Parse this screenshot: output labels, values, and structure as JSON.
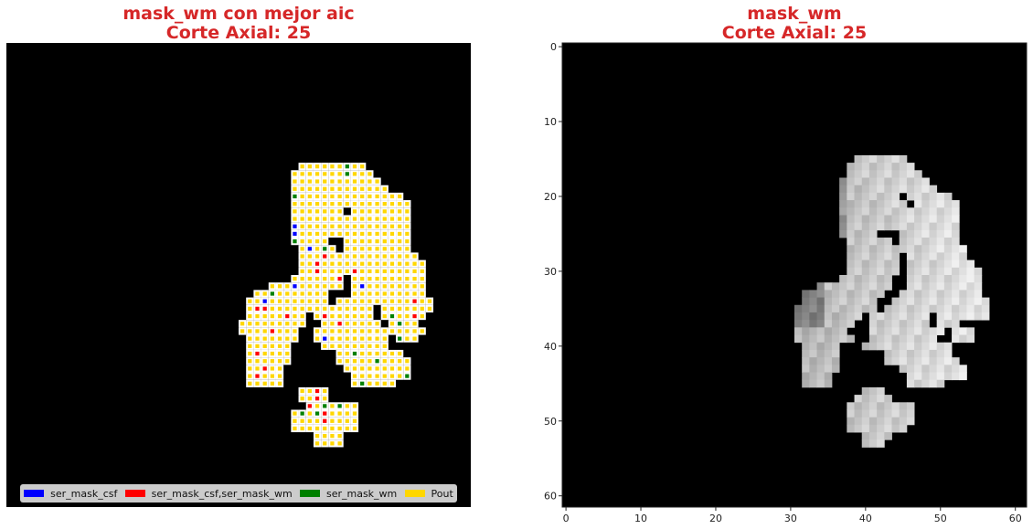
{
  "chart_data": [
    {
      "type": "heatmap",
      "title_line1": "mask_wm con mejor aic",
      "title_line2": "Corte Axial: 25",
      "grid_size": 62,
      "axes_visible": false,
      "legend_location": "bottom",
      "legend": [
        {
          "label": "ser_mask_csf",
          "color": "#0000ff"
        },
        {
          "label": "ser_mask_csf,ser_mask_wm",
          "color": "#ff0000"
        },
        {
          "label": "ser_mask_wm",
          "color": "#008000"
        },
        {
          "label": "Pout",
          "color": "#ffd700"
        }
      ],
      "row_spans": [
        [
          16,
          [
            [
              39,
              47
            ]
          ]
        ],
        [
          17,
          [
            [
              38,
              48
            ]
          ]
        ],
        [
          18,
          [
            [
              38,
              49
            ]
          ]
        ],
        [
          19,
          [
            [
              38,
              50
            ]
          ]
        ],
        [
          20,
          [
            [
              38,
              52
            ]
          ]
        ],
        [
          21,
          [
            [
              38,
              53
            ]
          ]
        ],
        [
          22,
          [
            [
              38,
              53
            ]
          ]
        ],
        [
          23,
          [
            [
              38,
              53
            ]
          ]
        ],
        [
          24,
          [
            [
              38,
              53
            ]
          ]
        ],
        [
          25,
          [
            [
              38,
              53
            ]
          ]
        ],
        [
          26,
          [
            [
              38,
              53
            ]
          ]
        ],
        [
          27,
          [
            [
              39,
              53
            ]
          ]
        ],
        [
          28,
          [
            [
              39,
              45
            ],
            [
              46,
              54
            ]
          ]
        ],
        [
          29,
          [
            [
              39,
              45
            ],
            [
              46,
              55
            ]
          ]
        ],
        [
          30,
          [
            [
              39,
              45
            ],
            [
              46,
              55
            ]
          ]
        ],
        [
          31,
          [
            [
              38,
              44
            ],
            [
              46,
              55
            ]
          ]
        ],
        [
          32,
          [
            [
              35,
              44
            ],
            [
              46,
              55
            ]
          ]
        ],
        [
          33,
          [
            [
              33,
              42
            ],
            [
              46,
              55
            ]
          ]
        ],
        [
          34,
          [
            [
              32,
              42
            ],
            [
              44,
              56
            ]
          ]
        ],
        [
          35,
          [
            [
              32,
              42
            ],
            [
              43,
              56
            ]
          ]
        ],
        [
          36,
          [
            [
              32,
              39
            ],
            [
              41,
              55
            ]
          ]
        ],
        [
          37,
          [
            [
              31,
              39
            ],
            [
              42,
              54
            ]
          ]
        ],
        [
          38,
          [
            [
              31,
              38
            ],
            [
              41,
              50
            ],
            [
              51,
              55
            ]
          ]
        ],
        [
          39,
          [
            [
              32,
              35
            ],
            [
              36,
              38
            ],
            [
              41,
              50
            ],
            [
              52,
              54
            ]
          ]
        ],
        [
          40,
          [
            [
              32,
              37
            ],
            [
              42,
              51
            ]
          ]
        ],
        [
          41,
          [
            [
              32,
              37
            ],
            [
              44,
              52
            ]
          ]
        ],
        [
          42,
          [
            [
              32,
              37
            ],
            [
              44,
              53
            ]
          ]
        ],
        [
          43,
          [
            [
              32,
              36
            ],
            [
              45,
              53
            ]
          ]
        ],
        [
          44,
          [
            [
              32,
              36
            ],
            [
              46,
              53
            ]
          ]
        ],
        [
          45,
          [
            [
              32,
              36
            ],
            [
              46,
              51
            ]
          ]
        ],
        [
          46,
          [
            [
              39,
              42
            ]
          ]
        ],
        [
          47,
          [
            [
              39,
              42
            ]
          ]
        ],
        [
          48,
          [
            [
              40,
              46
            ]
          ]
        ],
        [
          49,
          [
            [
              38,
              46
            ]
          ]
        ],
        [
          50,
          [
            [
              38,
              46
            ]
          ]
        ],
        [
          51,
          [
            [
              38,
              46
            ]
          ]
        ],
        [
          52,
          [
            [
              41,
              44
            ]
          ]
        ],
        [
          53,
          [
            [
              41,
              44
            ]
          ]
        ]
      ],
      "holes": [
        [
          22,
          45
        ],
        [
          26,
          43
        ],
        [
          26,
          44
        ],
        [
          27,
          44
        ],
        [
          35,
          49
        ],
        [
          36,
          49
        ],
        [
          37,
          50
        ],
        [
          40,
          51
        ]
      ],
      "markers": {
        "blue": [
          [
            24,
            38
          ],
          [
            25,
            38
          ],
          [
            27,
            40
          ],
          [
            32,
            38
          ],
          [
            32,
            47
          ],
          [
            34,
            34
          ],
          [
            37,
            41
          ],
          [
            39,
            42
          ],
          [
            40,
            41
          ]
        ],
        "red": [
          [
            28,
            42
          ],
          [
            29,
            41
          ],
          [
            30,
            41
          ],
          [
            30,
            46
          ],
          [
            31,
            44
          ],
          [
            34,
            54
          ],
          [
            35,
            33
          ],
          [
            35,
            34
          ],
          [
            36,
            37
          ],
          [
            36,
            42
          ],
          [
            36,
            54
          ],
          [
            37,
            44
          ],
          [
            38,
            35
          ],
          [
            39,
            31
          ],
          [
            41,
            33
          ],
          [
            43,
            34
          ],
          [
            44,
            33
          ],
          [
            46,
            41
          ],
          [
            47,
            41
          ],
          [
            48,
            40
          ],
          [
            49,
            42
          ],
          [
            50,
            42
          ]
        ],
        "green": [
          [
            16,
            45
          ],
          [
            17,
            45
          ],
          [
            20,
            38
          ],
          [
            26,
            38
          ],
          [
            27,
            42
          ],
          [
            33,
            35
          ],
          [
            36,
            51
          ],
          [
            37,
            52
          ],
          [
            39,
            52
          ],
          [
            41,
            46
          ],
          [
            42,
            49
          ],
          [
            44,
            53
          ],
          [
            45,
            47
          ],
          [
            48,
            42
          ],
          [
            48,
            44
          ],
          [
            49,
            39
          ],
          [
            49,
            41
          ]
        ]
      }
    },
    {
      "type": "heatmap",
      "title_line1": "mask_wm",
      "title_line2": "Corte Axial: 25",
      "grid_size": 62,
      "colormap": "gray",
      "x_ticks": [
        0,
        10,
        20,
        30,
        40,
        50,
        60
      ],
      "y_ticks": [
        0,
        10,
        20,
        30,
        40,
        50,
        60
      ],
      "xlim": [
        -0.5,
        61.5
      ],
      "ylim": [
        61.5,
        -0.5
      ],
      "row_spans": [
        [
          15,
          [
            [
              39,
              45
            ]
          ]
        ],
        [
          16,
          [
            [
              38,
              46
            ]
          ]
        ],
        [
          17,
          [
            [
              38,
              47
            ]
          ]
        ],
        [
          18,
          [
            [
              37,
              48
            ]
          ]
        ],
        [
          19,
          [
            [
              37,
              49
            ]
          ]
        ],
        [
          20,
          [
            [
              37,
              51
            ]
          ]
        ],
        [
          21,
          [
            [
              37,
              52
            ]
          ]
        ],
        [
          22,
          [
            [
              37,
              52
            ]
          ]
        ],
        [
          23,
          [
            [
              37,
              52
            ]
          ]
        ],
        [
          24,
          [
            [
              37,
              52
            ]
          ]
        ],
        [
          25,
          [
            [
              37,
              52
            ]
          ]
        ],
        [
          26,
          [
            [
              38,
              52
            ]
          ]
        ],
        [
          27,
          [
            [
              38,
              44
            ],
            [
              45,
              53
            ]
          ]
        ],
        [
          28,
          [
            [
              38,
              44
            ],
            [
              46,
              53
            ]
          ]
        ],
        [
          29,
          [
            [
              38,
              44
            ],
            [
              46,
              54
            ]
          ]
        ],
        [
          30,
          [
            [
              38,
              44
            ],
            [
              46,
              55
            ]
          ]
        ],
        [
          31,
          [
            [
              37,
              43
            ],
            [
              46,
              55
            ]
          ]
        ],
        [
          32,
          [
            [
              34,
              43
            ],
            [
              46,
              55
            ]
          ]
        ],
        [
          33,
          [
            [
              32,
              42
            ],
            [
              45,
              55
            ]
          ]
        ],
        [
          34,
          [
            [
              32,
              41
            ],
            [
              44,
              56
            ]
          ]
        ],
        [
          35,
          [
            [
              31,
              41
            ],
            [
              43,
              56
            ]
          ]
        ],
        [
          36,
          [
            [
              31,
              39
            ],
            [
              41,
              56
            ]
          ]
        ],
        [
          37,
          [
            [
              31,
              38
            ],
            [
              41,
              52
            ]
          ]
        ],
        [
          38,
          [
            [
              31,
              37
            ],
            [
              41,
              50
            ],
            [
              52,
              54
            ]
          ]
        ],
        [
          39,
          [
            [
              31,
              38
            ],
            [
              41,
              50
            ],
            [
              52,
              54
            ]
          ]
        ],
        [
          40,
          [
            [
              32,
              36
            ],
            [
              40,
              51
            ]
          ]
        ],
        [
          41,
          [
            [
              32,
              36
            ],
            [
              43,
              51
            ]
          ]
        ],
        [
          42,
          [
            [
              32,
              36
            ],
            [
              43,
              52
            ]
          ]
        ],
        [
          43,
          [
            [
              32,
              36
            ],
            [
              45,
              53
            ]
          ]
        ],
        [
          44,
          [
            [
              32,
              35
            ],
            [
              46,
              53
            ]
          ]
        ],
        [
          45,
          [
            [
              32,
              35
            ],
            [
              46,
              50
            ]
          ]
        ],
        [
          46,
          [
            [
              40,
              42
            ]
          ]
        ],
        [
          47,
          [
            [
              39,
              43
            ]
          ]
        ],
        [
          48,
          [
            [
              38,
              46
            ]
          ]
        ],
        [
          49,
          [
            [
              38,
              46
            ]
          ]
        ],
        [
          50,
          [
            [
              38,
              46
            ]
          ]
        ],
        [
          51,
          [
            [
              38,
              45
            ]
          ]
        ],
        [
          52,
          [
            [
              40,
              43
            ]
          ]
        ],
        [
          53,
          [
            [
              40,
              42
            ]
          ]
        ]
      ],
      "holes": [
        [
          20,
          45
        ],
        [
          21,
          46
        ],
        [
          25,
          42
        ],
        [
          25,
          43
        ],
        [
          25,
          44
        ],
        [
          26,
          44
        ],
        [
          36,
          49
        ],
        [
          37,
          49
        ],
        [
          39,
          50
        ]
      ]
    }
  ]
}
